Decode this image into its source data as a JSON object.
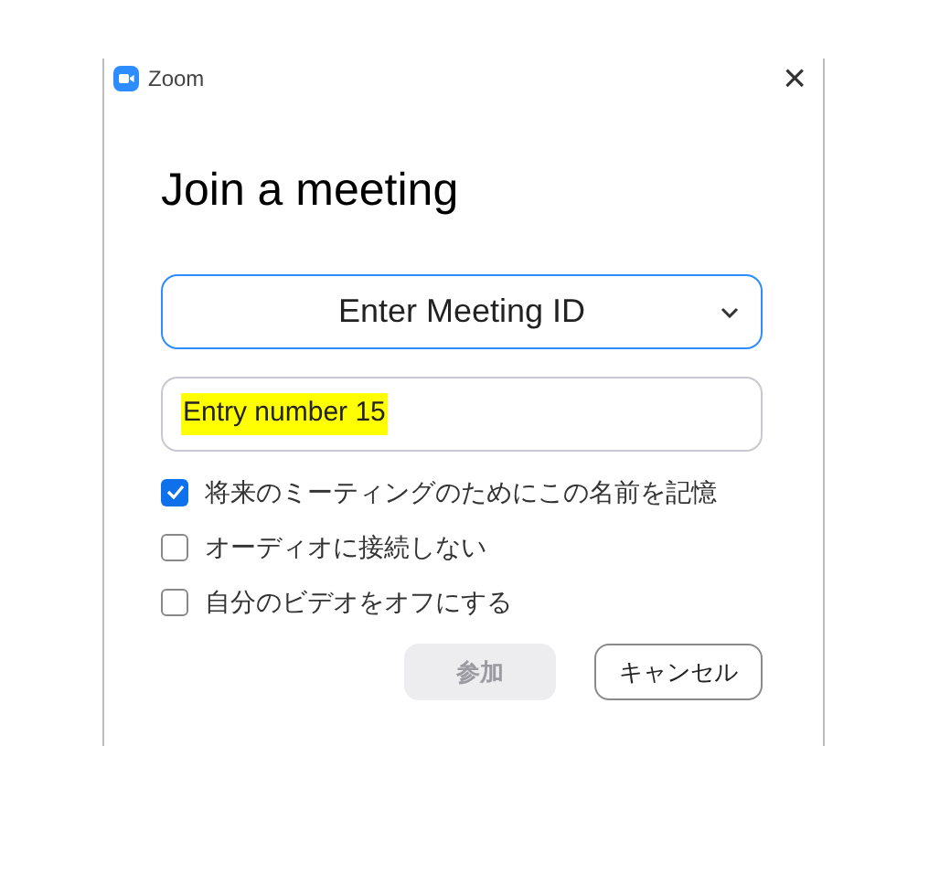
{
  "window": {
    "title": "Zoom",
    "close": "×"
  },
  "heading": "Join a meeting",
  "meeting_select": {
    "value": "Enter Meeting ID"
  },
  "name_field": {
    "value": "Entry number 15",
    "highlighted": true
  },
  "options": [
    {
      "label": "将来のミーティングのためにこの名前を記憶",
      "checked": true
    },
    {
      "label": "オーディオに接続しない",
      "checked": false
    },
    {
      "label": "自分のビデオをオフにする",
      "checked": false
    }
  ],
  "buttons": [
    {
      "label": "参加",
      "disabled": true
    },
    {
      "label": "キャンセル",
      "disabled": false
    }
  ]
}
